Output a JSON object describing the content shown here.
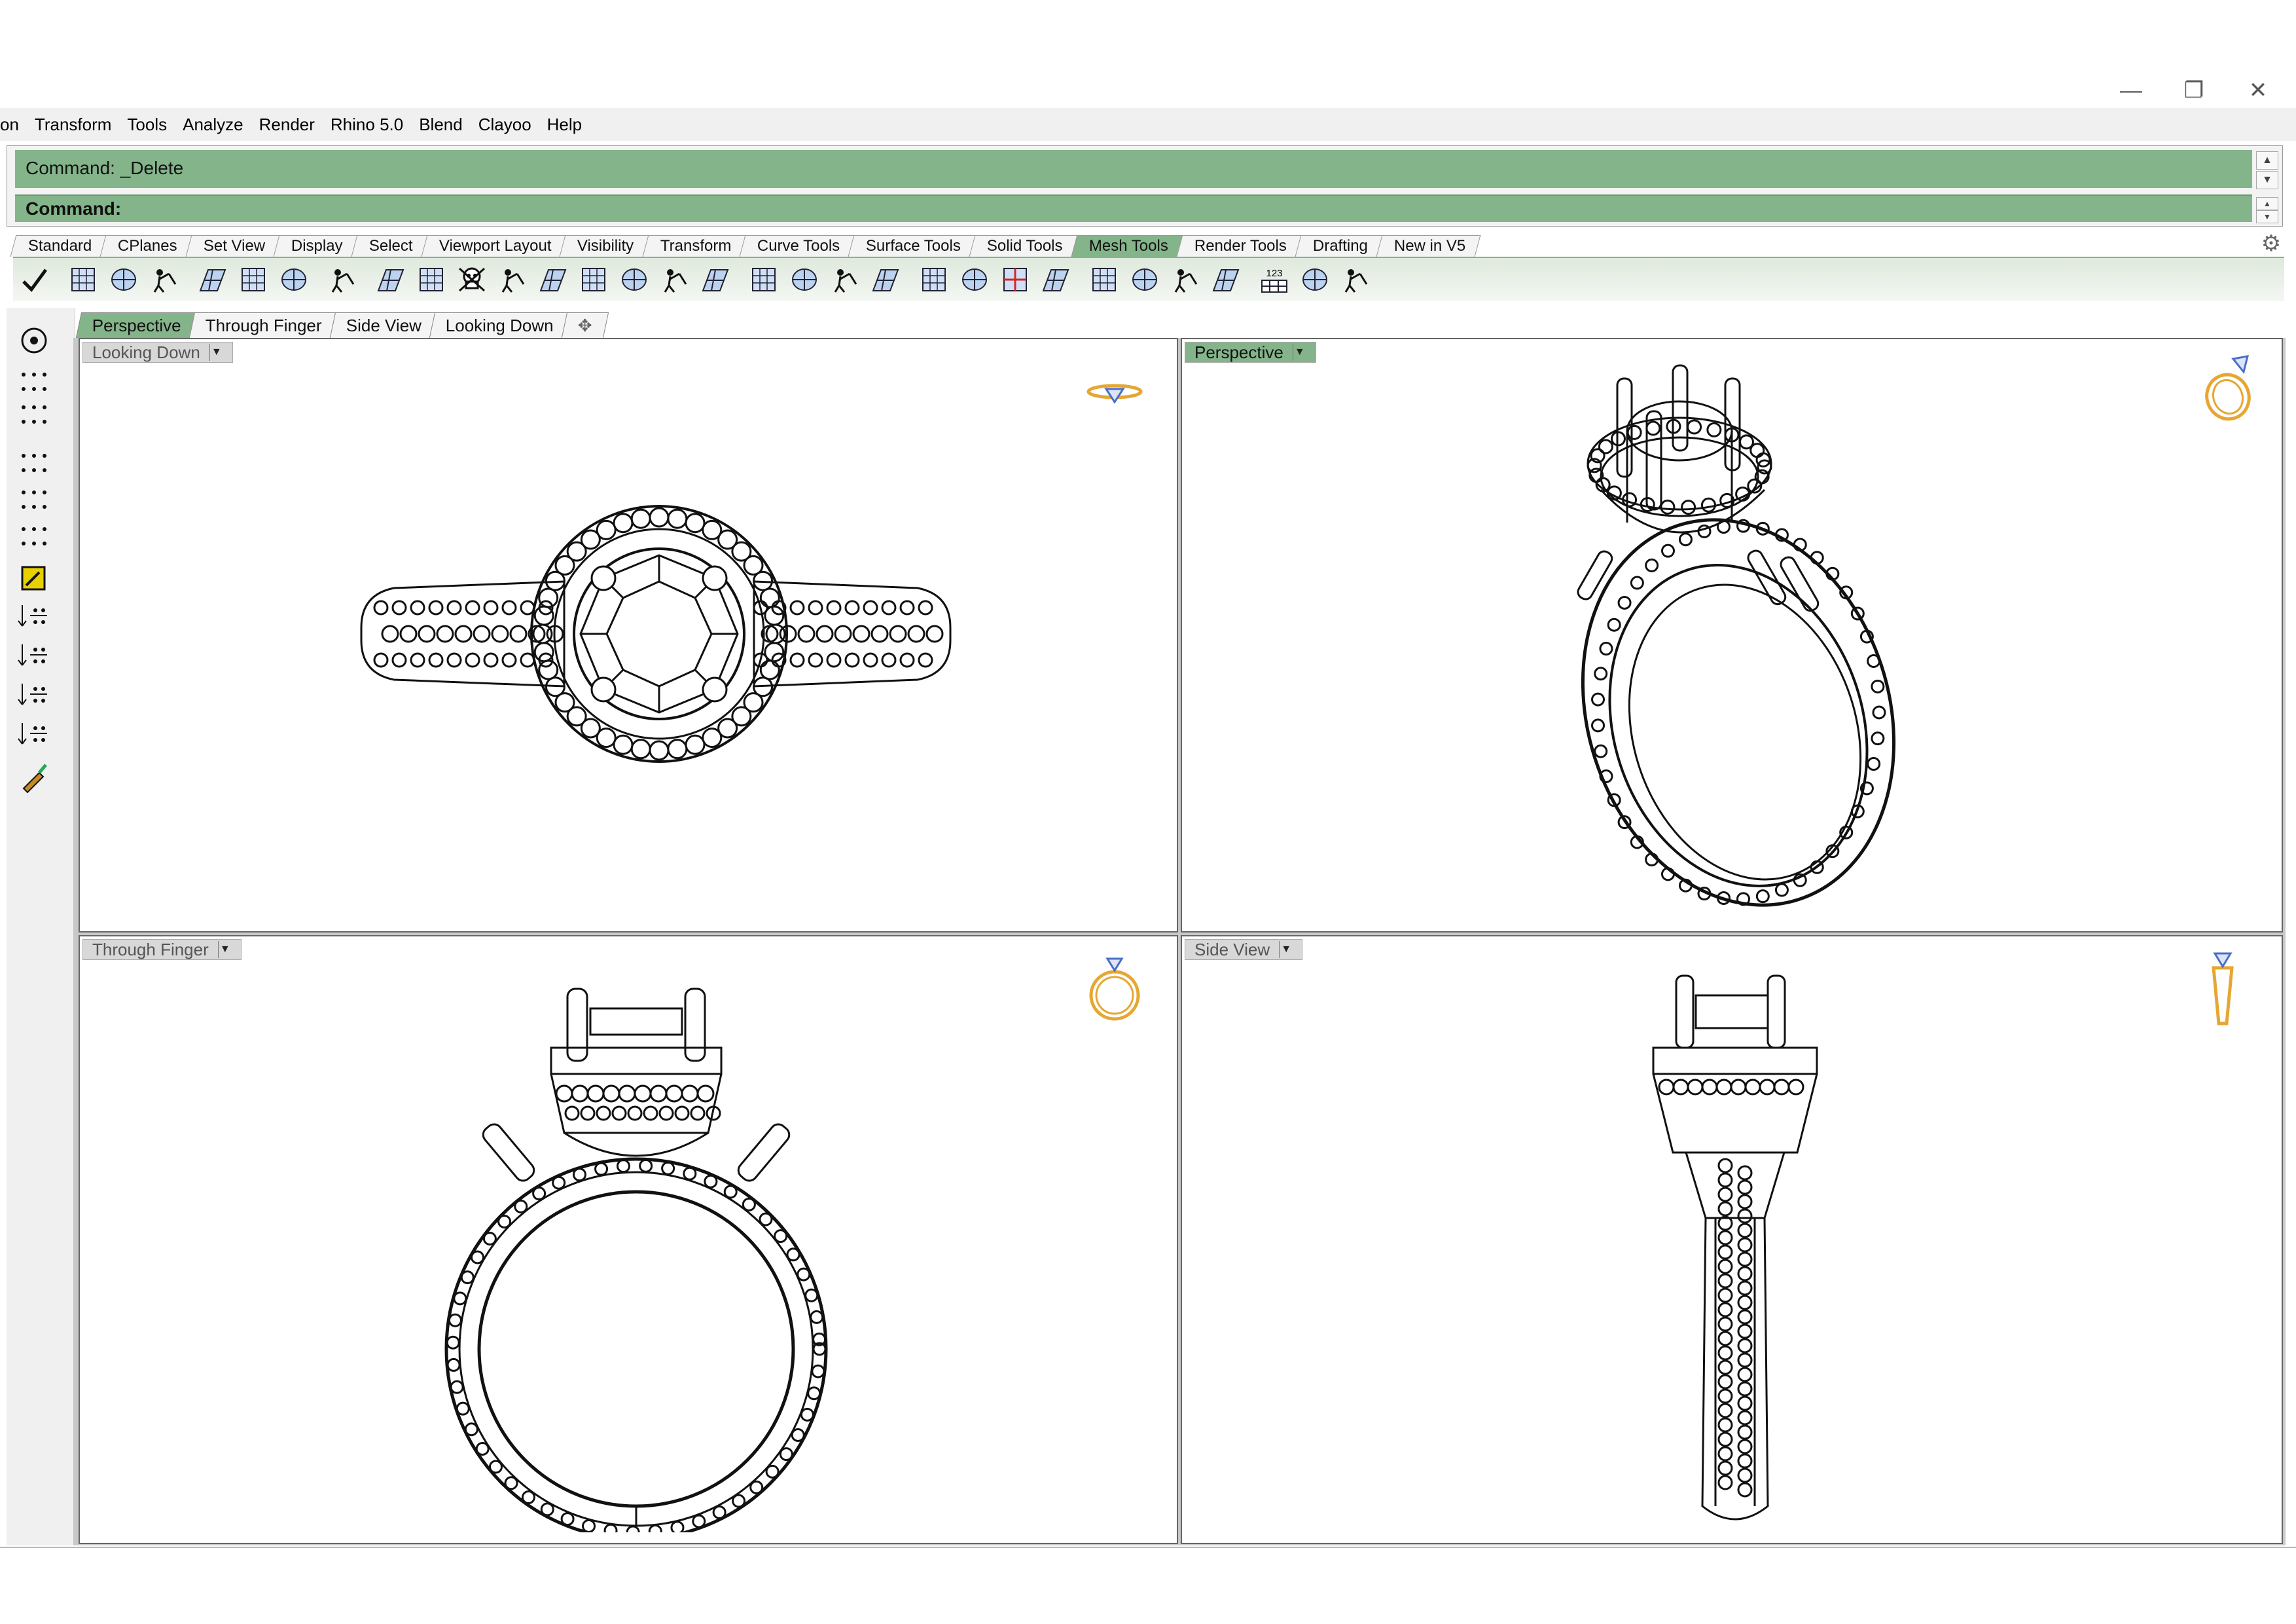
{
  "window": {
    "controls": [
      {
        "name": "minimize",
        "glyph": "—"
      },
      {
        "name": "restore",
        "glyph": "❐"
      },
      {
        "name": "close",
        "glyph": "✕"
      }
    ]
  },
  "menu": [
    "on",
    "Transform",
    "Tools",
    "Analyze",
    "Render",
    "Rhino 5.0",
    "Blend",
    "Clayoo",
    "Help"
  ],
  "command": {
    "history": "Command: _Delete",
    "prompt": "Command:"
  },
  "toolbar_tabs": {
    "items": [
      "Standard",
      "CPlanes",
      "Set View",
      "Display",
      "Select",
      "Viewport Layout",
      "Visibility",
      "Transform",
      "Curve Tools",
      "Surface Tools",
      "Solid Tools",
      "Mesh Tools",
      "Render Tools",
      "Drafting",
      "New in V5"
    ],
    "active": "Mesh Tools"
  },
  "toolbar_icons": [
    "check",
    "hammer-wrench",
    "mesh-box",
    "mesh-sphere",
    "mesh-grid",
    "figure-a",
    "figure-b",
    "figure-c",
    "mesh-cup",
    "mesh-patch",
    "skull",
    "mesh-cylinder",
    "mesh-cut",
    "mesh-torus",
    "mesh-weld",
    "mesh-plane-a",
    "mesh-plane-b",
    "mesh-plane-c",
    "mesh-shell",
    "mesh-join",
    "mesh-split",
    "mesh-trim",
    "mesh-knife",
    "mesh-red",
    "mesh-extrude",
    "mesh-select",
    "mesh-grid-b",
    "mesh-grid-c",
    "mesh-cube",
    "mesh-123",
    "mesh-repair",
    "mesh-warning"
  ],
  "toolbar_label_123": "123",
  "viewport_tabs": {
    "items": [
      "Perspective",
      "Through Finger",
      "Side View",
      "Looking Down"
    ],
    "active": "Perspective",
    "add_glyph": "✥"
  },
  "viewports": [
    {
      "label": "Looking Down",
      "active": false
    },
    {
      "label": "Perspective",
      "active": true
    },
    {
      "label": "Through Finger",
      "active": false
    },
    {
      "label": "Side View",
      "active": false
    }
  ],
  "colors": {
    "accent_green": "#84b48a",
    "gizmo_gold": "#e6a732",
    "gizmo_blue": "#4a6ec8"
  }
}
